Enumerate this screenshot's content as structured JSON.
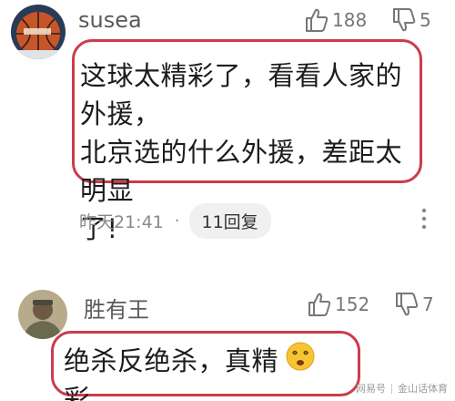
{
  "comments": [
    {
      "username": "susea",
      "likes": "188",
      "dislikes": "5",
      "text_lines": [
        "这球太精彩了，看看人家的外援，",
        "北京选的什么外援，差距太明显",
        "了!"
      ],
      "time": "昨天21:41",
      "separator": "·",
      "reply_label": "11回复",
      "avatar_icon": "basketball-avatar"
    },
    {
      "username": "胜有王",
      "likes": "152",
      "dislikes": "7",
      "text": "绝杀反绝杀，真精彩.",
      "avatar_icon": "person-photo-avatar",
      "emoji_icon": "dizzy-face-emoji"
    }
  ],
  "watermark": {
    "left": "网易号",
    "right": "金山话体育"
  },
  "colors": {
    "highlight_border": "#cc3b4e",
    "meta_text": "#8a8a8a",
    "icon_gray": "#777777"
  }
}
